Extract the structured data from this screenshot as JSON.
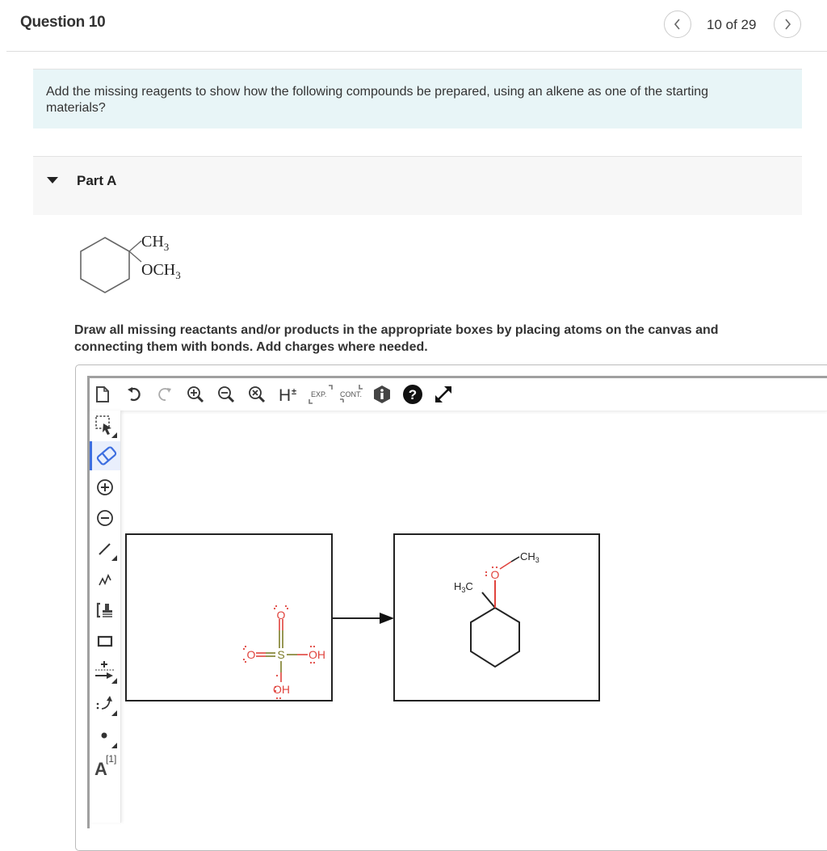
{
  "header": {
    "title": "Question 10",
    "counter": "10 of 29",
    "prev_icon": "chevron-left-icon",
    "next_icon": "chevron-right-icon"
  },
  "prompt": {
    "text": "Add the missing reagents to show how the following compounds be prepared, using an alkene as one of the starting materials?"
  },
  "part": {
    "label": "Part A",
    "expanded": true
  },
  "target_molecule": {
    "substituent_top": "CH",
    "substituent_top_sub": "3",
    "substituent_bottom": "OCH",
    "substituent_bottom_sub": "3"
  },
  "instruction": "Draw all missing reactants and/or products in the appropriate boxes by placing atoms on the canvas and connecting them with bonds. Add charges where needed.",
  "editor": {
    "top_toolbar": [
      {
        "name": "new-document",
        "icon": "new-document-icon"
      },
      {
        "name": "undo",
        "icon": "undo-icon"
      },
      {
        "name": "redo",
        "icon": "redo-icon"
      },
      {
        "name": "zoom-in",
        "icon": "zoom-in-icon"
      },
      {
        "name": "zoom-out",
        "icon": "zoom-out-icon"
      },
      {
        "name": "zoom-reset",
        "icon": "zoom-reset-icon"
      },
      {
        "name": "explicit-hydrogens",
        "icon": "hydrogen-toggle-icon",
        "label": "H±"
      },
      {
        "name": "expand",
        "icon": "expand-icon",
        "label": "EXP."
      },
      {
        "name": "contract",
        "icon": "contract-icon",
        "label": "CONT."
      },
      {
        "name": "info",
        "icon": "info-icon"
      },
      {
        "name": "help",
        "icon": "help-icon"
      },
      {
        "name": "fullscreen",
        "icon": "fullscreen-icon"
      }
    ],
    "left_toolbar": [
      {
        "name": "select",
        "icon": "select-lasso-icon"
      },
      {
        "name": "erase",
        "icon": "eraser-icon",
        "selected": true
      },
      {
        "name": "positive-charge",
        "icon": "plus-charge-icon"
      },
      {
        "name": "negative-charge",
        "icon": "minus-charge-icon"
      },
      {
        "name": "single-bond",
        "icon": "bond-icon"
      },
      {
        "name": "chain",
        "icon": "chain-icon"
      },
      {
        "name": "template",
        "icon": "template-bracket-icon"
      },
      {
        "name": "rectangle",
        "icon": "rectangle-icon"
      },
      {
        "name": "reaction-arrow",
        "icon": "reaction-arrow-icon"
      },
      {
        "name": "electron-arrow",
        "icon": "electron-arrow-icon"
      },
      {
        "name": "radical",
        "icon": "radical-dot-icon"
      },
      {
        "name": "atom-label",
        "icon": "atom-label-icon",
        "label": "A",
        "superscript": "[1]"
      }
    ],
    "reactant_box": {
      "molecule": "H2SO4",
      "atoms": {
        "s": "S",
        "o_top": "O",
        "o_left": "O",
        "oh_right": "OH",
        "oh_bottom": "OH"
      }
    },
    "product_box": {
      "molecule": "1-methoxy-1-methylcyclohexane",
      "labels": {
        "methyl_left": "H",
        "methyl_left_sub": "3",
        "methyl_left_c": "C",
        "oxygen": "O",
        "methyl_right": "CH",
        "methyl_right_sub": "3"
      }
    },
    "colors": {
      "oxygen": "#e0443e",
      "sulfur": "#7d7d2a",
      "bond": "#222222",
      "selected_tool": "#3d6ee0"
    }
  }
}
